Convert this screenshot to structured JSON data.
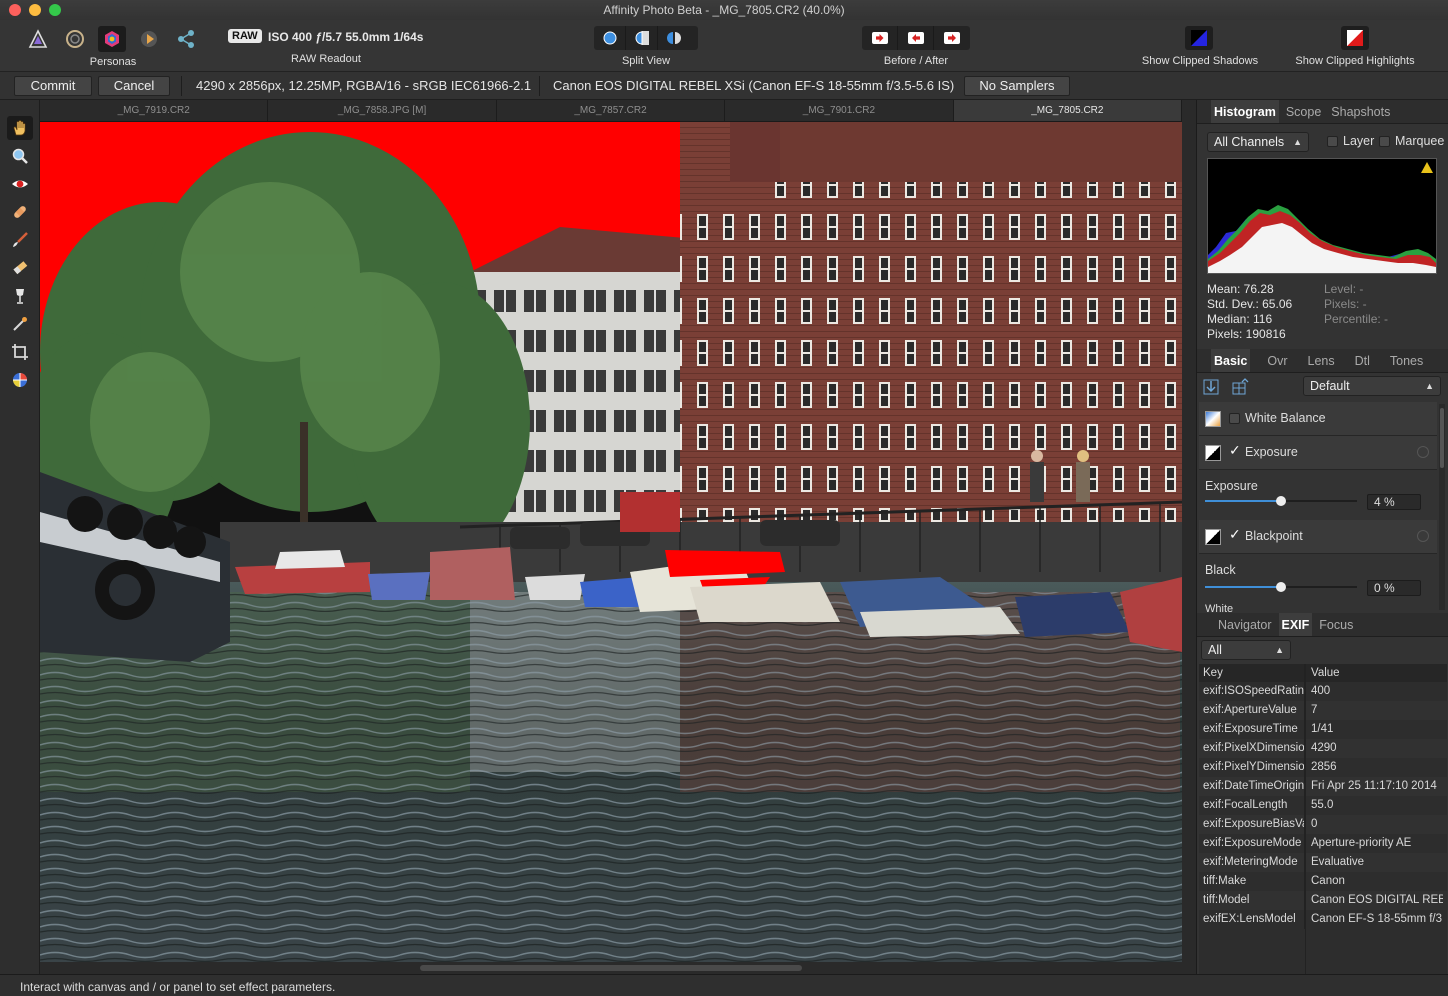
{
  "window": {
    "title": "Affinity Photo Beta - _MG_7805.CR2 (40.0%)"
  },
  "toolbar": {
    "personas_label": "Personas",
    "raw_badge": "RAW",
    "raw_readout_text": "ISO 400 ƒ/5.7 55.0mm 1/64s",
    "raw_readout_label": "RAW Readout",
    "split_view_label": "Split View",
    "before_after_label": "Before / After",
    "show_clipped_shadows_label": "Show Clipped Shadows",
    "show_clipped_highlights_label": "Show Clipped Highlights"
  },
  "context": {
    "commit_label": "Commit",
    "cancel_label": "Cancel",
    "image_info": "4290 x 2856px, 12.25MP, RGBA/16 - sRGB IEC61966-2.1",
    "camera_info": "Canon EOS DIGITAL REBEL XSi (Canon EF-S 18-55mm f/3.5-5.6 IS)",
    "samplers_label": "No Samplers"
  },
  "tabs": [
    {
      "label": "_MG_7919.CR2"
    },
    {
      "label": "_MG_7858.JPG [M]"
    },
    {
      "label": "_MG_7857.CR2"
    },
    {
      "label": "_MG_7901.CR2"
    },
    {
      "label": "_MG_7805.CR2"
    }
  ],
  "histogram_panel": {
    "tabs": [
      "Histogram",
      "Scope",
      "Shapshots"
    ],
    "channel": "All Channels",
    "layer_label": "Layer",
    "marquee_label": "Marquee",
    "mean": "Mean: 76.28",
    "std_dev": "Std. Dev.: 65.06",
    "median": "Median: 116",
    "pixels": "Pixels: 190816",
    "level": "Level: -",
    "pixels_sel": "Pixels: -",
    "percentile": "Percentile: -"
  },
  "develop_panel": {
    "tabs": [
      "Basic",
      "Ovr",
      "Lens",
      "Dtl",
      "Tones"
    ],
    "preset": "Default",
    "white_balance_label": "White Balance",
    "exposure_section": "Exposure",
    "exposure_slider_label": "Exposure",
    "exposure_value": "4 %",
    "exposure_level": 0.5,
    "blackpoint_section": "Blackpoint",
    "black_slider_label": "Black",
    "black_value": "0 %",
    "black_level": 0.5,
    "white_partial": "White"
  },
  "exif_panel": {
    "tabs": [
      "Navigator",
      "EXIF",
      "Focus"
    ],
    "filter": "All",
    "key_header": "Key",
    "value_header": "Value",
    "rows": [
      {
        "key": "exif:ISOSpeedRatin",
        "value": "400"
      },
      {
        "key": "exif:ApertureValue",
        "value": "7"
      },
      {
        "key": "exif:ExposureTime",
        "value": "1/41"
      },
      {
        "key": "exif:PixelXDimensio",
        "value": "4290"
      },
      {
        "key": "exif:PixelYDimensio",
        "value": "2856"
      },
      {
        "key": "exif:DateTimeOrigin",
        "value": "Fri Apr 25 11:17:10 2014"
      },
      {
        "key": "exif:FocalLength",
        "value": "55.0"
      },
      {
        "key": "exif:ExposureBiasVa",
        "value": "0"
      },
      {
        "key": "exif:ExposureMode",
        "value": "Aperture-priority AE"
      },
      {
        "key": "exif:MeteringMode",
        "value": "Evaluative"
      },
      {
        "key": "tiff:Make",
        "value": "Canon"
      },
      {
        "key": "tiff:Model",
        "value": "Canon EOS DIGITAL REB"
      },
      {
        "key": "exifEX:LensModel",
        "value": "Canon EF-S 18-55mm f/3"
      }
    ]
  },
  "status": {
    "text": "Interact with canvas and / or panel to set effect parameters."
  },
  "colors": {
    "clip_highlight": "#ff0000",
    "accent": "#3f8fd8",
    "warning": "#e8c21a"
  },
  "icons": {
    "tools": [
      "hand-icon",
      "zoom-icon",
      "red-eye-icon",
      "healing-icon",
      "brush-icon",
      "eraser-icon",
      "wine-glass-icon",
      "eyedropper-icon",
      "crop-icon",
      "white-balance-icon"
    ]
  }
}
